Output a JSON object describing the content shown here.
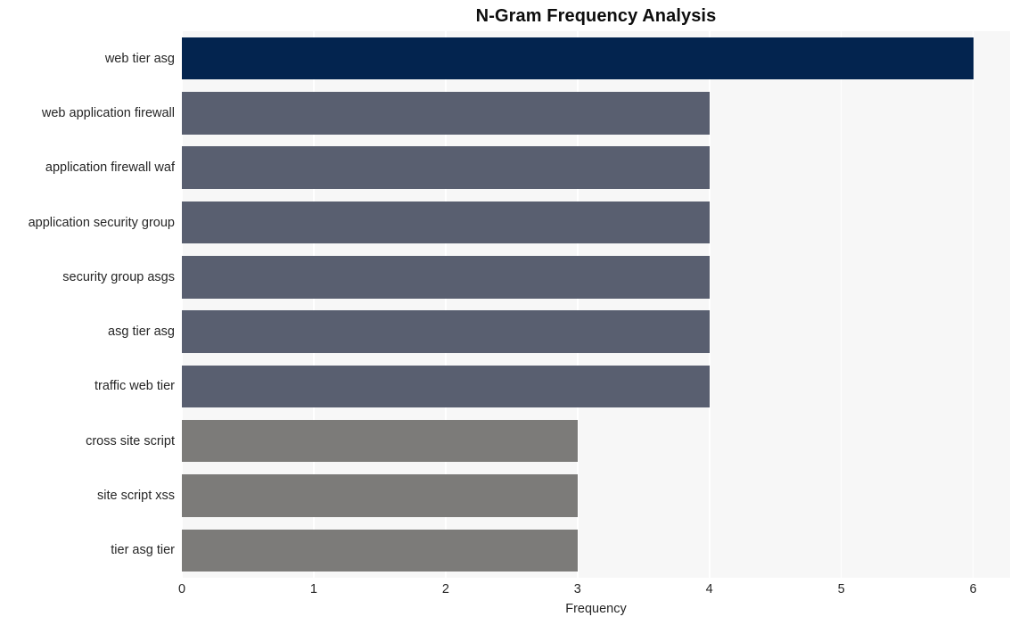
{
  "chart_data": {
    "type": "bar",
    "orientation": "horizontal",
    "title": "N-Gram Frequency Analysis",
    "xlabel": "Frequency",
    "ylabel": "",
    "categories": [
      "web tier asg",
      "web application firewall",
      "application firewall waf",
      "application security group",
      "security group asgs",
      "asg tier asg",
      "traffic web tier",
      "cross site script",
      "site script xss",
      "tier asg tier"
    ],
    "values": [
      6,
      4,
      4,
      4,
      4,
      4,
      4,
      3,
      3,
      3
    ],
    "bar_colors": [
      "#03244f",
      "#595f70",
      "#595f70",
      "#595f70",
      "#595f70",
      "#595f70",
      "#595f70",
      "#7c7b79",
      "#7c7b79",
      "#7c7b79"
    ],
    "xlim": [
      0,
      6.28
    ],
    "xticks": [
      0,
      1,
      2,
      3,
      4,
      5,
      6
    ],
    "xtick_labels": [
      "0",
      "1",
      "2",
      "3",
      "4",
      "5",
      "6"
    ],
    "grid": true,
    "grid_axis": "x",
    "grid_color": "#ffffff",
    "plot_background": "#f7f7f7",
    "figure_background": "#ffffff",
    "legend": null
  }
}
